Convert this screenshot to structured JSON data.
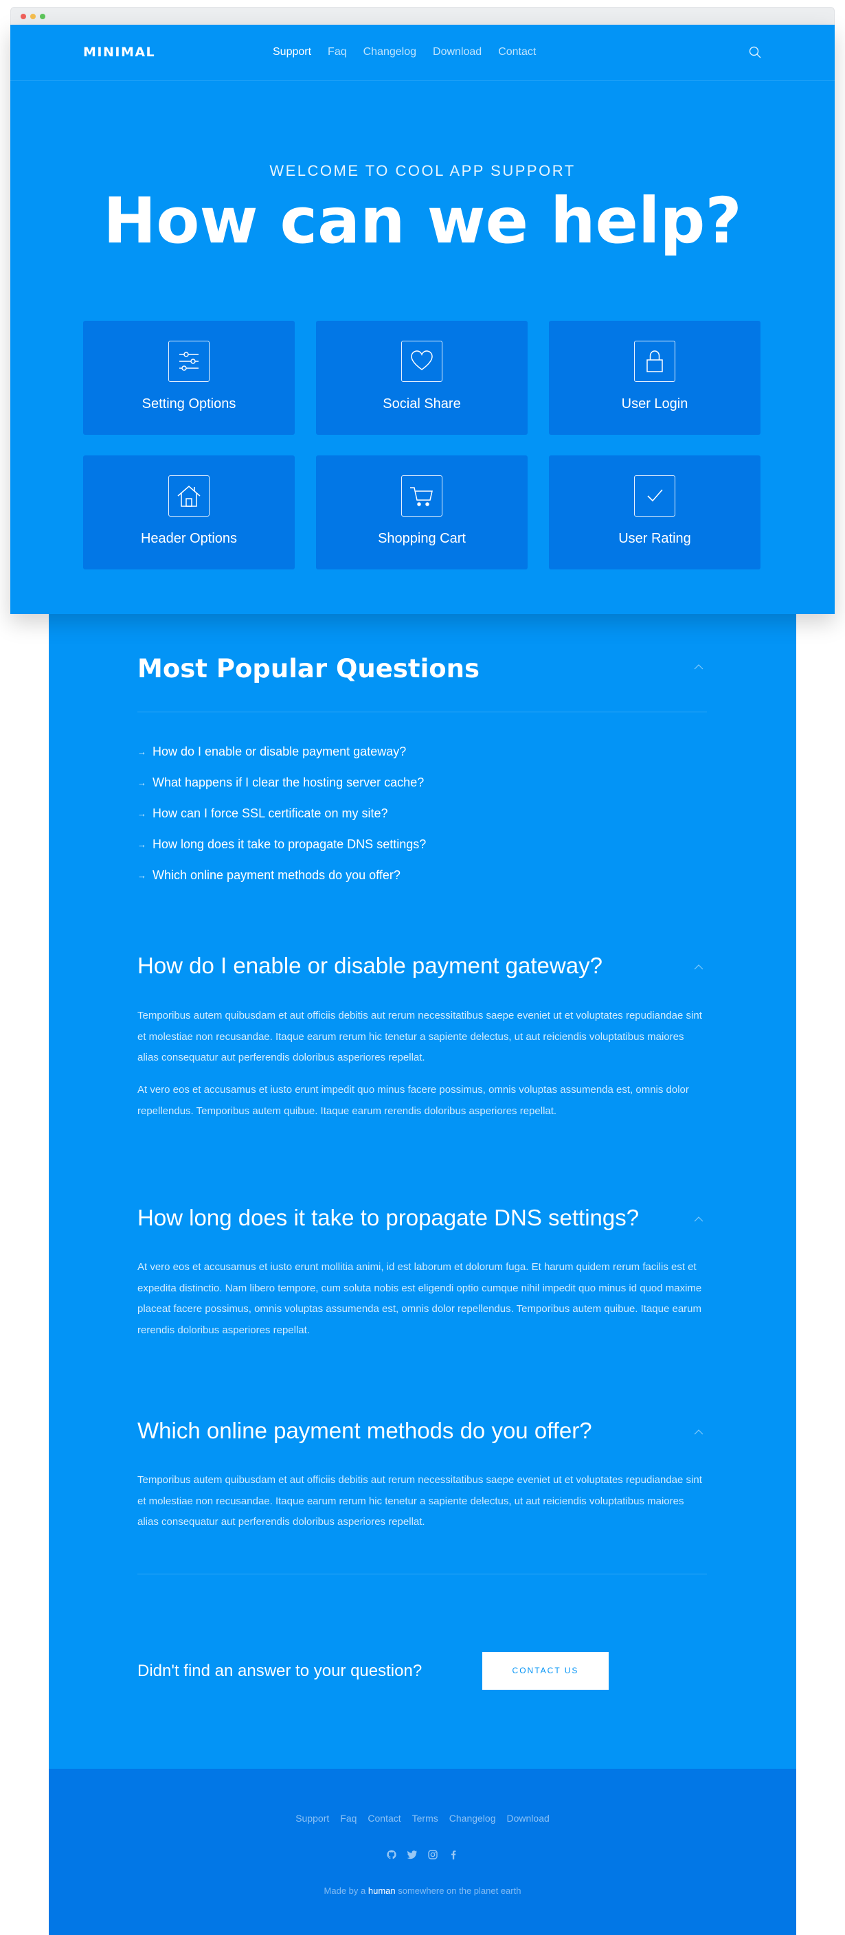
{
  "nav": {
    "logo": "MINIMAL",
    "links": [
      "Support",
      "Faq",
      "Changelog",
      "Download",
      "Contact"
    ]
  },
  "hero": {
    "welcome": "WELCOME TO COOL APP SUPPORT",
    "title": "How can we help?",
    "cards": [
      {
        "label": "Setting Options",
        "icon": "sliders-icon"
      },
      {
        "label": "Social Share",
        "icon": "heart-icon"
      },
      {
        "label": "User Login",
        "icon": "lock-icon"
      },
      {
        "label": "Header Options",
        "icon": "home-icon"
      },
      {
        "label": "Shopping Cart",
        "icon": "cart-icon"
      },
      {
        "label": "User Rating",
        "icon": "check-icon"
      }
    ]
  },
  "popular": {
    "title": "Most Popular Questions",
    "questions": [
      "How do I enable or disable payment gateway?",
      "What happens if I clear the hosting server cache?",
      "How can I force SSL certificate on my site?",
      "How long does it take to propagate DNS settings?",
      "Which online payment methods do you offer?"
    ]
  },
  "answers": [
    {
      "title": "How do I enable or disable payment gateway?",
      "paragraphs": [
        "Temporibus autem quibusdam et aut officiis debitis aut rerum necessitatibus saepe eveniet ut et voluptates repudiandae sint et molestiae non recusandae. Itaque earum rerum hic tenetur a sapiente delectus, ut aut reiciendis voluptatibus maiores alias consequatur aut perferendis doloribus asperiores repellat.",
        "At vero eos et accusamus et iusto erunt impedit quo minus facere possimus, omnis voluptas assumenda est, omnis dolor repellendus. Temporibus autem quibue. Itaque earum rerendis doloribus asperiores repellat."
      ]
    },
    {
      "title": "How long does it take to propagate DNS settings?",
      "paragraphs": [
        "At vero eos et accusamus et iusto erunt mollitia animi, id est laborum et dolorum fuga. Et harum quidem rerum facilis est et expedita distinctio. Nam libero tempore, cum soluta nobis est eligendi optio cumque nihil impedit quo minus id quod maxime placeat facere possimus, omnis voluptas assumenda est, omnis dolor repellendus. Temporibus autem quibue. Itaque earum rerendis doloribus asperiores repellat."
      ]
    },
    {
      "title": "Which online payment methods do you offer?",
      "paragraphs": [
        "Temporibus autem quibusdam et aut officiis debitis aut rerum necessitatibus saepe eveniet ut et voluptates repudiandae sint et molestiae non recusandae. Itaque earum rerum hic tenetur a sapiente delectus, ut aut reiciendis voluptatibus maiores alias consequatur aut perferendis doloribus asperiores repellat."
      ]
    }
  ],
  "cta": {
    "text": "Didn't find an answer to your question?",
    "button": "CONTACT US"
  },
  "footer": {
    "links": [
      "Support",
      "Faq",
      "Contact",
      "Terms",
      "Changelog",
      "Download"
    ],
    "socials": [
      "github-icon",
      "twitter-icon",
      "instagram-icon",
      "facebook-icon"
    ],
    "credit_before": "Made by a",
    "credit_highlight": "human",
    "credit_after": "somewhere on the planet earth"
  },
  "colors": {
    "primary": "#0394f6",
    "card": "#0277e6",
    "footer": "#0277e6",
    "button_text": "#0394f6"
  }
}
